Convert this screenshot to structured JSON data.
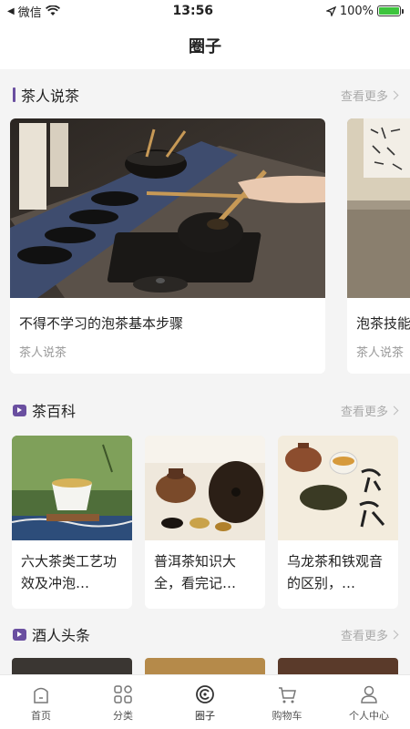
{
  "status_bar": {
    "carrier": "微信",
    "time": "13:56",
    "battery_percent": "100%",
    "battery_level": 1.0
  },
  "nav": {
    "title": "圈子"
  },
  "sections": [
    {
      "title": "茶人说茶",
      "more": "查看更多",
      "cards": [
        {
          "title": "不得不学习的泡茶基本步骤",
          "subtitle": "茶人说茶",
          "image": "tea-ceremony-image"
        },
        {
          "title": "泡茶技能",
          "subtitle": "茶人说茶",
          "image": "calligraphy-image"
        }
      ]
    },
    {
      "title": "茶百科",
      "more": "查看更多",
      "cards": [
        {
          "title": "六大茶类工艺功效及冲泡…",
          "image": "tea-cup-image"
        },
        {
          "title": "普洱茶知识大全，看完记…",
          "image": "puer-tea-image"
        },
        {
          "title": "乌龙茶和铁观音的区别，…",
          "image": "oolong-tea-image"
        }
      ]
    },
    {
      "title": "酒人头条",
      "more": "查看更多"
    }
  ],
  "tabs": [
    {
      "label": "首页",
      "icon": "home-icon"
    },
    {
      "label": "分类",
      "icon": "category-icon"
    },
    {
      "label": "圈子",
      "icon": "circle-icon",
      "active": true
    },
    {
      "label": "购物车",
      "icon": "cart-icon"
    },
    {
      "label": "个人中心",
      "icon": "user-icon"
    }
  ],
  "colors": {
    "accent": "#6a4fa0",
    "battery": "#3dc43d",
    "background": "#f4f4f4"
  },
  "image_text": {
    "calligraphy": "一壶清茶 沉静心"
  }
}
